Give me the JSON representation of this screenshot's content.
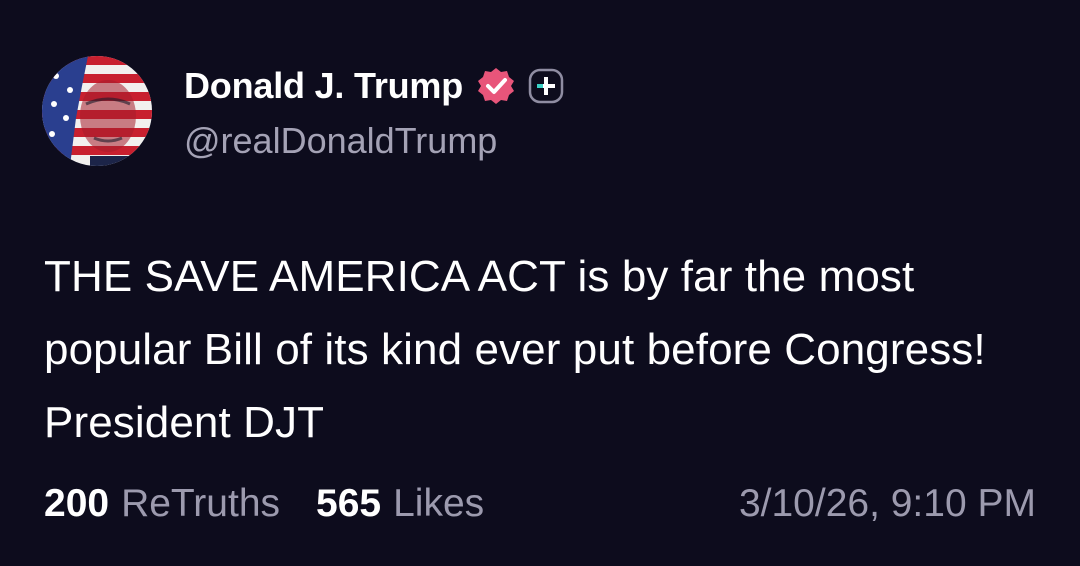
{
  "post": {
    "author": {
      "display_name": "Donald J. Trump",
      "handle": "@realDonaldTrump",
      "verified_icon": "verified-badge-icon",
      "plus_icon": "plus-badge-icon",
      "avatar": "flag-portrait-avatar"
    },
    "text": "THE SAVE AMERICA ACT is by far the most popular Bill of its kind ever put before Congress! President DJT",
    "stats": {
      "retruths_count": "200",
      "retruths_label": "ReTruths",
      "likes_count": "565",
      "likes_label": "Likes"
    },
    "timestamp": "3/10/26, 9:10 PM"
  },
  "colors": {
    "background": "#0d0c1d",
    "text_primary": "#ffffff",
    "text_secondary": "#9c9aae",
    "verified_pink": "#e8557a"
  }
}
